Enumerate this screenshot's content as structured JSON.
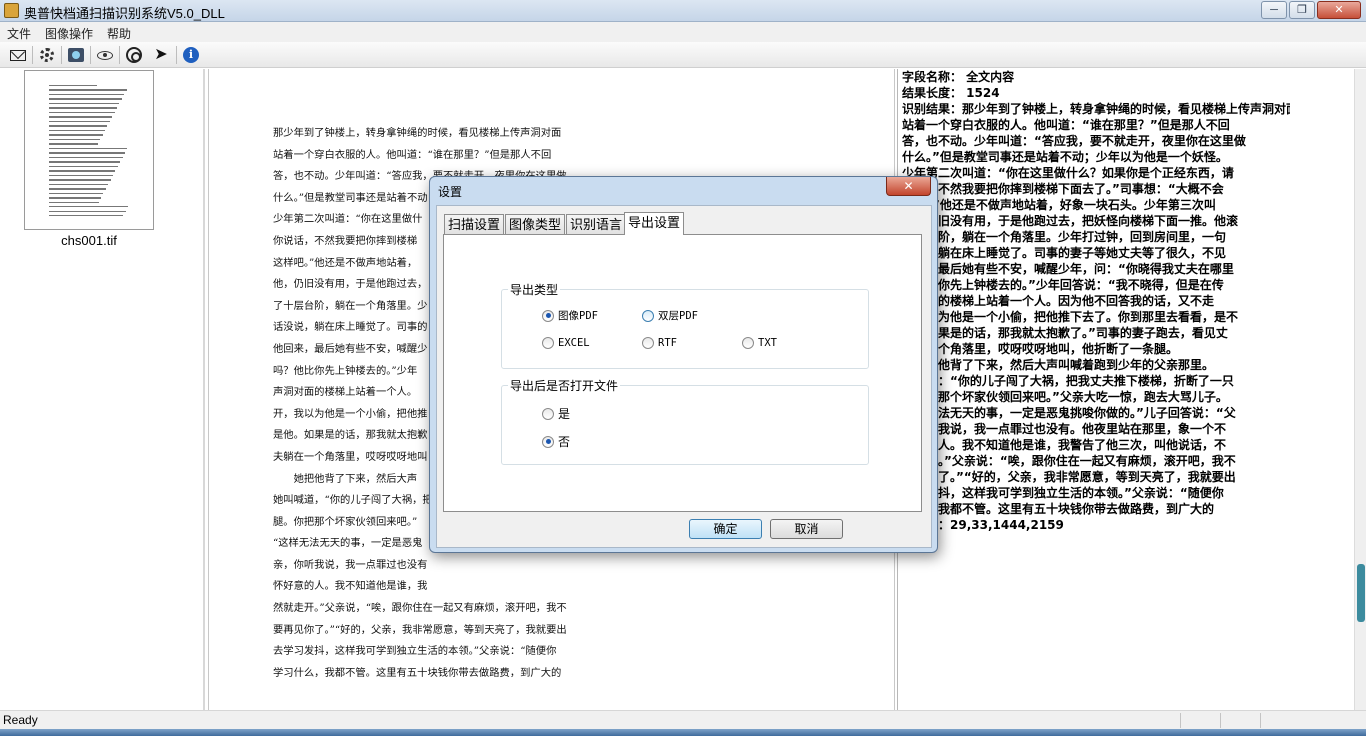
{
  "window": {
    "title": "奥普快档通扫描识别系统V5.0_DLL",
    "close_glyph": "✕",
    "minimize_glyph": "─",
    "maximize_glyph": "❐"
  },
  "menu": [
    "文件",
    "图像操作",
    "帮助"
  ],
  "toolbar": {
    "icons": [
      "mail-icon",
      "settings-icon",
      "scanner-icon",
      "eye-icon",
      "target-icon",
      "arrow-right-icon",
      "info-icon"
    ],
    "info_glyph": "i",
    "arrow_glyph": "➤"
  },
  "thumbnail": {
    "filename": "chs001.tif"
  },
  "document_lines": [
    "那少年到了钟楼上，转身拿钟绳的时候，看见楼梯上传声洞对面",
    "站着一个穿白衣服的人。他叫道：“谁在那里？”但是那人不回",
    "答，也不动。少年叫道：“答应我，要不就走开，夜里你在这里做",
    "什么。”但是教堂司事还是站着不动；少年以为他是一个妖怪。",
    "少年第二次叫道：“你在这里做什",
    "你说话，不然我要把你摔到楼梯",
    "这样吧。”他还是不做声地站着，",
    "他，仍旧没有用，于是他跑过去，",
    "了十层台阶，躺在一个角落里。少",
    "话没说，躺在床上睡觉了。司事的",
    "他回来，最后她有些不安，喊醒少",
    "吗？他比你先上钟楼去的。”少年",
    "声洞对面的楼梯上站着一个人。",
    "开，我以为他是一个小偷，把他推",
    "是他。如果是的话，那我就太抱歉",
    "夫躺在一个角落里，哎呀哎呀地叫",
    "　　她把他背了下来，然后大声",
    "她叫喊道，“你的儿子闯了大祸，把",
    "腿。你把那个坏家伙领回来吧。”",
    "“这样无法无天的事，一定是恶鬼",
    "亲，你听我说，我一点罪过也没有",
    "怀好意的人。我不知道他是谁，我",
    "然就走开。”父亲说，“唉，跟你住在一起又有麻烦，滚开吧，我不",
    "要再见你了。”“好的，父亲，我非常愿意，等到天亮了，我就要出",
    "去学习发抖，这样我可学到独立生活的本领。”父亲说：“随便你",
    "学习什么，我都不管。这里有五十块钱你带去做路费，到广大的"
  ],
  "recognition_lines": [
    "字段名称： 全文内容",
    "结果长度： 1524",
    "识别结果：那少年到了钟楼上，转身拿钟绳的时候，看见楼梯上传声洞对面",
    "站着一个穿白衣服的人。他叫道：“谁在那里？”但是那人不回",
    "答，也不动。少年叫道：“答应我，要不就走开，夜里你在这里做",
    "什么。”但是教堂司事还是站着不动；少年以为他是一个妖怪。",
    "少年第二次叫道：“你在这里做什么？如果你是个正经东西，请",
    "　　，不然我要把你摔到楼梯下面去了。”司事想：“大概不会",
    "　　。”他还是不做声地站着，好象一块石头。少年第三次叫",
    "　　仍旧没有用，于是他跑过去，把妖怪向楼梯下面一推。他滚",
    "　　台阶，躺在一个角落里。少年打过钟，回到房间里，一句",
    "　　，躺在床上睡觉了。司事的妻子等她丈夫等了很久，不见",
    "　　，最后她有些不安，喊醒少年，问：“你晓得我丈夫在哪里",
    "　　比你先上钟楼去的。”少年回答说：“我不晓得，但是在传",
    "　　面的楼梯上站着一个人。因为他不回答我的话，又不走",
    "　　以为他是一个小偷，把他推下去了。你到那里去看看，是不",
    "　　如果是的话，那我就太抱歉了。”司事的妻子跑去，看见丈",
    "　　一个角落里，哎呀哎呀地叫，他折断了一条腿。",
    "　　把他背了下来，然后大声叫喊着跑到少年的父亲那里。",
    "　　道：“你的儿子闯了大祸，把我丈夫推下楼梯，折断了一只",
    "　　把那个坏家伙领回来吧。”父亲大吃一惊，跑去大骂儿子。",
    "　　无法无天的事，一定是恶鬼挑唆你做的。”儿子回答说：“父",
    "　　听我说，我一点罪过也没有。他夜里站在那里，象一个不",
    "　　的人。我不知道他是谁，我警告了他三次，叫他说话，不",
    "　　开。”父亲说：“唉，跟你住在一起又有麻烦，滚开吧，我不",
    "　　你了。”“好的，父亲，我非常愿意，等到天亮了，我就要出",
    "　　发抖，这样我可学到独立生活的本领。”父亲说：“随便你",
    "　　，我都不管。这里有五十块钱你带去做路费，到广大的",
    "　　标：29,33,1444,2159"
  ],
  "status": {
    "text": "Ready"
  },
  "dialog": {
    "title": "设置",
    "close_glyph": "✕",
    "tabs": [
      "扫描设置",
      "图像类型",
      "识别语言",
      "导出设置"
    ],
    "active_tab": 3,
    "export_type": {
      "title": "导出类型",
      "options": [
        "图像PDF",
        "双层PDF",
        "EXCEL",
        "RTF",
        "TXT"
      ],
      "selected": "图像PDF"
    },
    "open_after_export": {
      "title": "导出后是否打开文件",
      "options": [
        "是",
        "否"
      ],
      "selected": "否"
    },
    "ok_label": "确定",
    "cancel_label": "取消"
  }
}
